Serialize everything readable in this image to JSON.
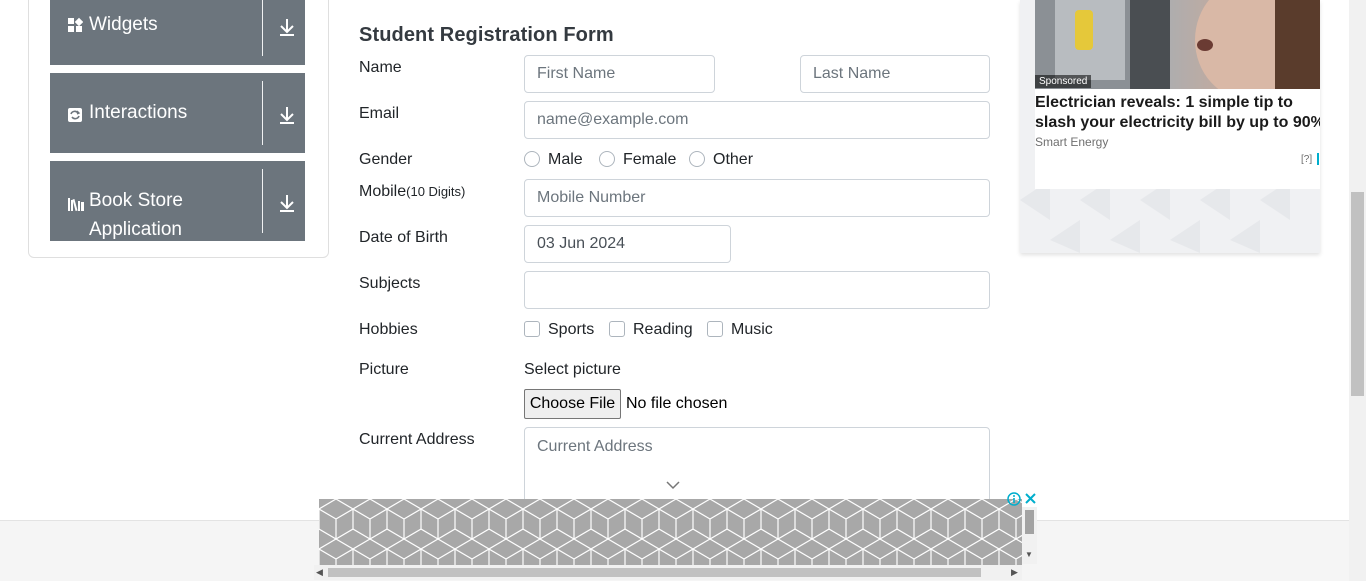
{
  "sidebar": {
    "groups": [
      {
        "label": "Widgets",
        "icon": "widgets-icon"
      },
      {
        "label": "Interactions",
        "icon": "interactions-icon"
      },
      {
        "label": "Book Store Application",
        "label_line1": "Book Store",
        "label_line2": "Application",
        "icon": "book-store-icon"
      }
    ]
  },
  "form": {
    "title": "Student Registration Form",
    "name_label": "Name",
    "first_name_placeholder": "First Name",
    "last_name_placeholder": "Last Name",
    "email_label": "Email",
    "email_placeholder": "name@example.com",
    "gender_label": "Gender",
    "gender_options": [
      "Male",
      "Female",
      "Other"
    ],
    "mobile_label": "Mobile",
    "mobile_hint": "(10 Digits)",
    "mobile_placeholder": "Mobile Number",
    "dob_label": "Date of Birth",
    "dob_value": "03 Jun 2024",
    "subjects_label": "Subjects",
    "subjects_value": "",
    "hobbies_label": "Hobbies",
    "hobby_options": [
      "Sports",
      "Reading",
      "Music"
    ],
    "picture_label": "Picture",
    "picture_prompt": "Select picture",
    "choose_file_label": "Choose File",
    "file_status": "No file chosen",
    "address_label": "Current Address",
    "address_placeholder": "Current Address"
  },
  "ad_right": {
    "sponsored": "Sponsored",
    "headline": "Electrician reveals: 1 simple tip to slash your electricity bill by up to 90%",
    "source": "Smart Energy",
    "question_mark": "[?]"
  },
  "colors": {
    "sidebar_header": "#6c757d",
    "input_border": "#ced4da",
    "ad_link": "#00aecd"
  }
}
